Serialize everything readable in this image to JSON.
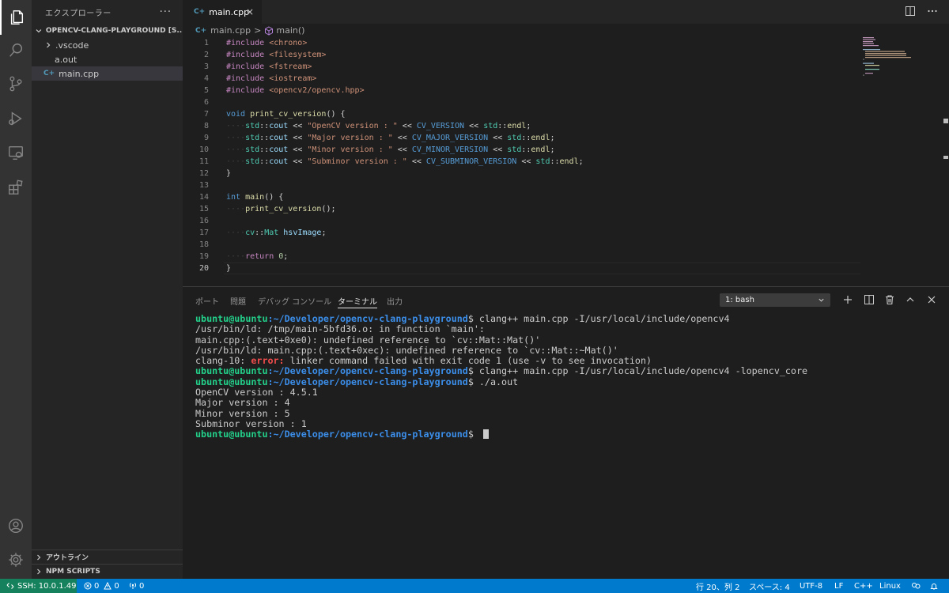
{
  "sidebar": {
    "title": "エクスプローラー",
    "more": "···",
    "folder": "OPENCV-CLANG-PLAYGROUND [S...",
    "items": [
      {
        "label": ".vscode",
        "type": "folder"
      },
      {
        "label": "a.out",
        "type": "file"
      },
      {
        "label": "main.cpp",
        "type": "cpp"
      }
    ],
    "cpp_glyph": "C+",
    "outline": "アウトライン",
    "npm": "NPM SCRIPTS"
  },
  "tabs": {
    "active": {
      "glyph": "C+",
      "label": "main.cpp",
      "close": "×"
    }
  },
  "breadcrumb": {
    "file": "main.cpp",
    "sep": ">",
    "symbol": "main()"
  },
  "code_lines": [
    {
      "n": "1",
      "tokens": [
        [
          "pp",
          "#include "
        ],
        [
          "str",
          "<chrono>"
        ]
      ]
    },
    {
      "n": "2",
      "tokens": [
        [
          "pp",
          "#include "
        ],
        [
          "str",
          "<filesystem>"
        ]
      ]
    },
    {
      "n": "3",
      "tokens": [
        [
          "pp",
          "#include "
        ],
        [
          "str",
          "<fstream>"
        ]
      ]
    },
    {
      "n": "4",
      "tokens": [
        [
          "pp",
          "#include "
        ],
        [
          "str",
          "<iostream>"
        ]
      ]
    },
    {
      "n": "5",
      "tokens": [
        [
          "pp",
          "#include "
        ],
        [
          "str",
          "<opencv2/opencv.hpp>"
        ]
      ]
    },
    {
      "n": "6",
      "tokens": []
    },
    {
      "n": "7",
      "tokens": [
        [
          "kw",
          "void "
        ],
        [
          "fn",
          "print_cv_version"
        ],
        [
          "txt",
          "() {"
        ]
      ]
    },
    {
      "n": "8",
      "tokens": [
        [
          "ws",
          "····"
        ],
        [
          "ns",
          "std"
        ],
        [
          "txt",
          "::"
        ],
        [
          "var",
          "cout"
        ],
        [
          "txt",
          " << "
        ],
        [
          "str",
          "\"OpenCV version : \""
        ],
        [
          "txt",
          " << "
        ],
        [
          "macro",
          "CV_VERSION"
        ],
        [
          "txt",
          " << "
        ],
        [
          "ns",
          "std"
        ],
        [
          "txt",
          "::"
        ],
        [
          "fn",
          "endl"
        ],
        [
          "txt",
          ";"
        ]
      ]
    },
    {
      "n": "9",
      "tokens": [
        [
          "ws",
          "····"
        ],
        [
          "ns",
          "std"
        ],
        [
          "txt",
          "::"
        ],
        [
          "var",
          "cout"
        ],
        [
          "txt",
          " << "
        ],
        [
          "str",
          "\"Major version : \""
        ],
        [
          "txt",
          " << "
        ],
        [
          "macro",
          "CV_MAJOR_VERSION"
        ],
        [
          "txt",
          " << "
        ],
        [
          "ns",
          "std"
        ],
        [
          "txt",
          "::"
        ],
        [
          "fn",
          "endl"
        ],
        [
          "txt",
          ";"
        ]
      ]
    },
    {
      "n": "10",
      "tokens": [
        [
          "ws",
          "····"
        ],
        [
          "ns",
          "std"
        ],
        [
          "txt",
          "::"
        ],
        [
          "var",
          "cout"
        ],
        [
          "txt",
          " << "
        ],
        [
          "str",
          "\"Minor version : \""
        ],
        [
          "txt",
          " << "
        ],
        [
          "macro",
          "CV_MINOR_VERSION"
        ],
        [
          "txt",
          " << "
        ],
        [
          "ns",
          "std"
        ],
        [
          "txt",
          "::"
        ],
        [
          "fn",
          "endl"
        ],
        [
          "txt",
          ";"
        ]
      ]
    },
    {
      "n": "11",
      "tokens": [
        [
          "ws",
          "····"
        ],
        [
          "ns",
          "std"
        ],
        [
          "txt",
          "::"
        ],
        [
          "var",
          "cout"
        ],
        [
          "txt",
          " << "
        ],
        [
          "str",
          "\"Subminor version : \""
        ],
        [
          "txt",
          " << "
        ],
        [
          "macro",
          "CV_SUBMINOR_VERSION"
        ],
        [
          "txt",
          " << "
        ],
        [
          "ns",
          "std"
        ],
        [
          "txt",
          "::"
        ],
        [
          "fn",
          "endl"
        ],
        [
          "txt",
          ";"
        ]
      ]
    },
    {
      "n": "12",
      "tokens": [
        [
          "txt",
          "}"
        ]
      ]
    },
    {
      "n": "13",
      "tokens": []
    },
    {
      "n": "14",
      "tokens": [
        [
          "kw",
          "int "
        ],
        [
          "fn",
          "main"
        ],
        [
          "txt",
          "() {"
        ]
      ]
    },
    {
      "n": "15",
      "tokens": [
        [
          "ws",
          "····"
        ],
        [
          "fn",
          "print_cv_version"
        ],
        [
          "txt",
          "();"
        ]
      ]
    },
    {
      "n": "16",
      "tokens": []
    },
    {
      "n": "17",
      "tokens": [
        [
          "ws",
          "····"
        ],
        [
          "ns",
          "cv"
        ],
        [
          "txt",
          "::"
        ],
        [
          "ns",
          "Mat"
        ],
        [
          "txt",
          " "
        ],
        [
          "var",
          "hsvImage"
        ],
        [
          "txt",
          ";"
        ]
      ]
    },
    {
      "n": "18",
      "tokens": []
    },
    {
      "n": "19",
      "tokens": [
        [
          "ws",
          "····"
        ],
        [
          "pp",
          "return "
        ],
        [
          "num",
          "0"
        ],
        [
          "txt",
          ";"
        ]
      ]
    },
    {
      "n": "20",
      "tokens": [
        [
          "txt",
          "}"
        ]
      ]
    }
  ],
  "panel": {
    "tabs": [
      "ポート",
      "問題",
      "デバッグ コンソール",
      "ターミナル",
      "出力"
    ],
    "active_tab": "ターミナル",
    "terminal_select": "1: bash",
    "user": "ubuntu@ubuntu",
    "path": ":~/Developer/opencv-clang-playground",
    "prompt_suffix": "$ ",
    "cmd1": "clang++ main.cpp -I/usr/local/include/opencv4",
    "out1": "/usr/bin/ld: /tmp/main-5bfd36.o: in function `main':",
    "out2": "main.cpp:(.text+0xe0): undefined reference to `cv::Mat::Mat()'",
    "out3": "/usr/bin/ld: main.cpp:(.text+0xec): undefined reference to `cv::Mat::~Mat()'",
    "out4_prefix": "clang-10: ",
    "out4_error": "error:",
    "out4_rest": " linker command failed with exit code 1 (use -v to see invocation)",
    "cmd2": "clang++ main.cpp -I/usr/local/include/opencv4 -lopencv_core",
    "cmd3": "./a.out",
    "res1": "OpenCV version : 4.5.1",
    "res2": "Major version : 4",
    "res3": "Minor version : 5",
    "res4": "Subminor version : 1"
  },
  "status": {
    "remote": "SSH: 10.0.1.49",
    "errors": "0",
    "warnings": "0",
    "ports": "0",
    "position": "行 20、列 2",
    "spaces": "スペース: 4",
    "encoding": "UTF-8",
    "eol": "LF",
    "language": "C++",
    "os": "Linux"
  },
  "colors": {
    "status_bg": "#007acc",
    "remote_bg": "#16825d",
    "accent": "#ffffff"
  }
}
